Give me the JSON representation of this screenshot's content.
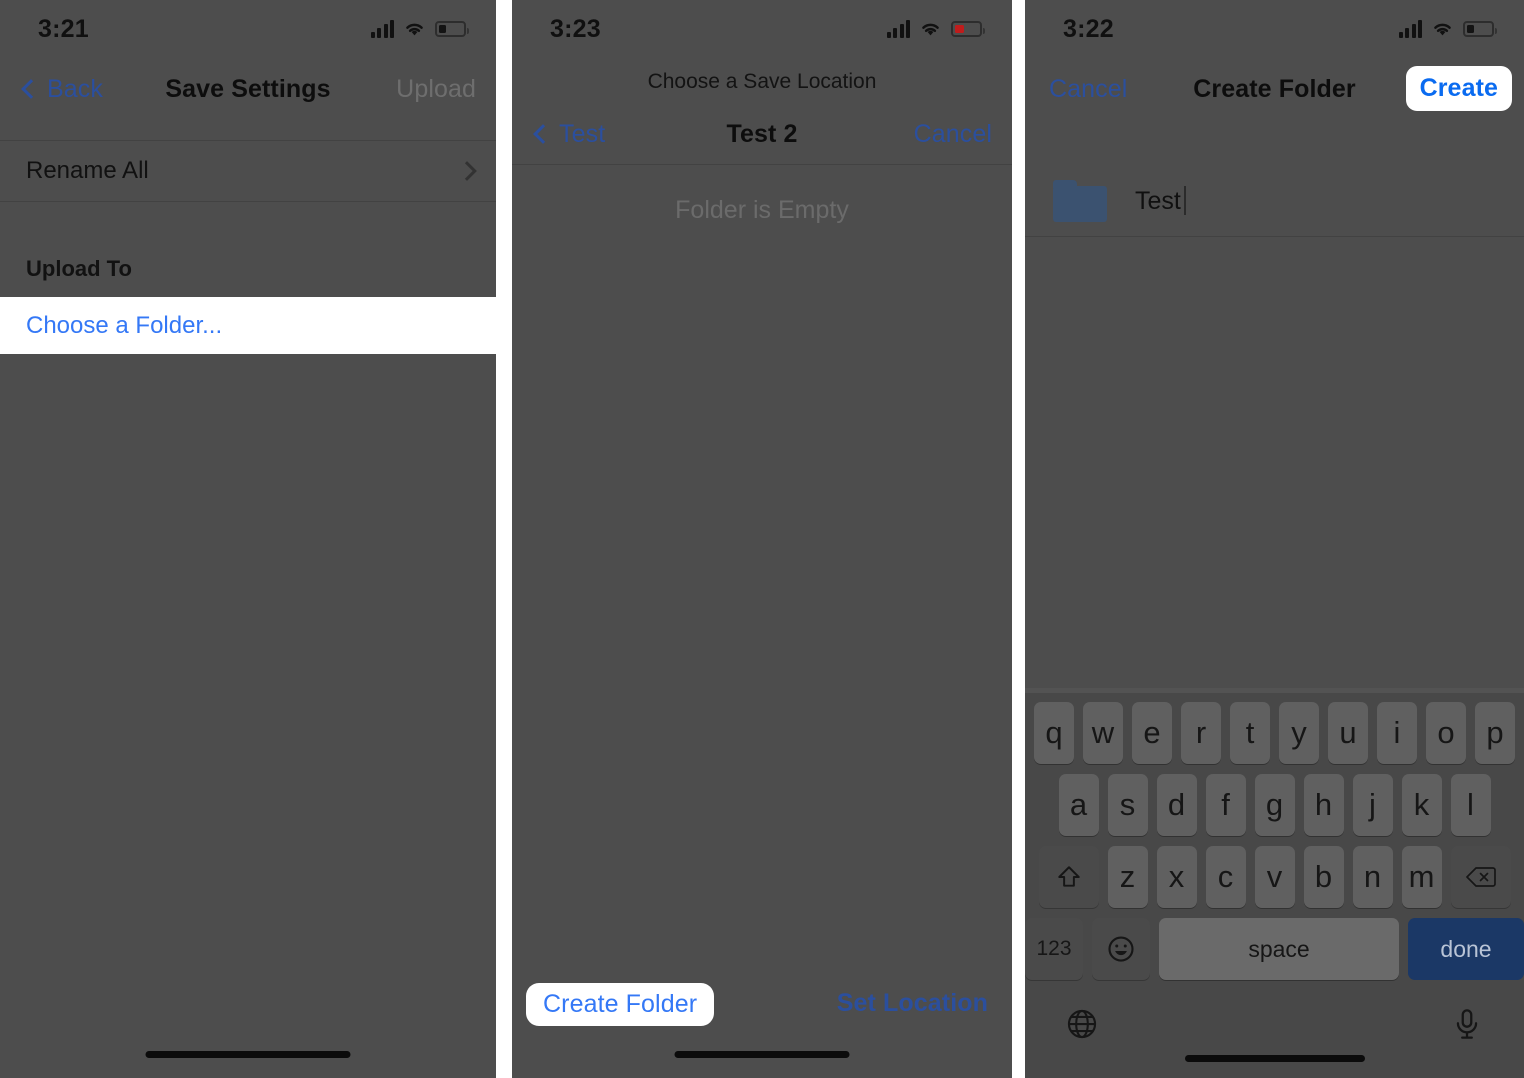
{
  "panels": [
    {
      "id": "save-settings",
      "status": {
        "time": "3:21",
        "battery_state": "low"
      },
      "nav": {
        "back_label": "Back",
        "title": "Save Settings",
        "action_label": "Upload",
        "action_disabled": true
      },
      "rows": [
        {
          "label": "Rename All",
          "accessory": "chevron-right-icon"
        }
      ],
      "section_header": "Upload To",
      "highlighted_row": {
        "label": "Choose a Folder...",
        "highlight_color": "#ffffff",
        "text_color": "#3478f6"
      }
    },
    {
      "id": "choose-save-location",
      "status": {
        "time": "3:23",
        "battery_state": "critical"
      },
      "sheet_title": "Choose a Save Location",
      "nav": {
        "back_label": "Test",
        "title": "Test 2",
        "action_label": "Cancel"
      },
      "empty_message": "Folder is Empty",
      "toolbar": {
        "left_label": "Create Folder",
        "left_highlighted": true,
        "right_label": "Set Location"
      }
    },
    {
      "id": "create-folder",
      "status": {
        "time": "3:22",
        "battery_state": "low"
      },
      "nav": {
        "cancel_label": "Cancel",
        "title": "Create Folder",
        "action_label": "Create",
        "action_highlighted": true
      },
      "folder_field": {
        "name": "Test",
        "icon": "folder-icon",
        "has_caret": true
      },
      "keyboard": {
        "row1": [
          "q",
          "w",
          "e",
          "r",
          "t",
          "y",
          "u",
          "i",
          "o",
          "p"
        ],
        "row2": [
          "a",
          "s",
          "d",
          "f",
          "g",
          "h",
          "j",
          "k",
          "l"
        ],
        "row3": [
          "z",
          "x",
          "c",
          "v",
          "b",
          "n",
          "m"
        ],
        "shift_icon": "shift-icon",
        "delete_icon": "backspace-icon",
        "numeric_label": "123",
        "emoji_icon": "emoji-icon",
        "space_label": "space",
        "done_label": "done",
        "globe_icon": "globe-icon",
        "mic_icon": "microphone-icon"
      }
    }
  ],
  "theme": {
    "dim_background": "#4d4d4d",
    "ios_blue": "#3478f6",
    "dim_blue": "#2b4f9e",
    "folder_blue": "#3b5270",
    "done_key": "#1b3866",
    "battery_critical": "#c01c1c"
  }
}
